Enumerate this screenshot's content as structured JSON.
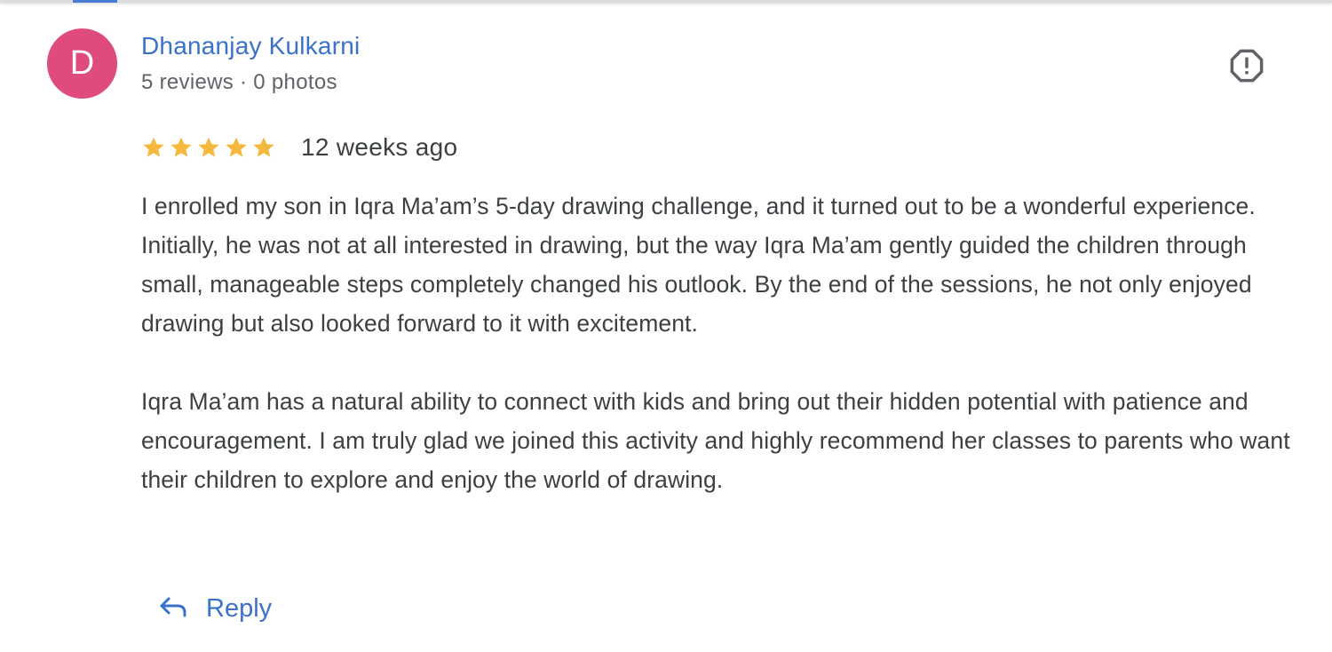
{
  "review": {
    "avatar_letter": "D",
    "avatar_color": "#df4b7c",
    "reviewer_name": "Dhananjay Kulkarni",
    "reviewer_meta": "5 reviews · 0 photos",
    "rating": 5,
    "rating_max": 5,
    "star_color": "#f4b93c",
    "date": "12 weeks ago",
    "paragraphs": [
      "I enrolled my son in Iqra Ma’am’s 5-day drawing challenge, and it turned out to be a wonderful experience. Initially, he was not at all interested in drawing, but the way Iqra Ma’am gently guided the children through small, manageable steps completely changed his outlook. By the end of the sessions, he not only enjoyed drawing but also looked forward to it with excitement.",
      "Iqra Ma’am has a natural ability to connect with kids and bring out their hidden potential with patience and encouragement. I am truly glad we joined this activity and highly recommend her classes to parents who want their children to explore and enjoy the world of drawing."
    ]
  },
  "actions": {
    "report_icon": "report-octagon-icon",
    "reply_icon": "reply-arrow-icon",
    "reply_label": "Reply"
  },
  "colors": {
    "link_blue": "#3a71c9",
    "text": "#3c4043",
    "secondary_text": "#5f6368"
  }
}
